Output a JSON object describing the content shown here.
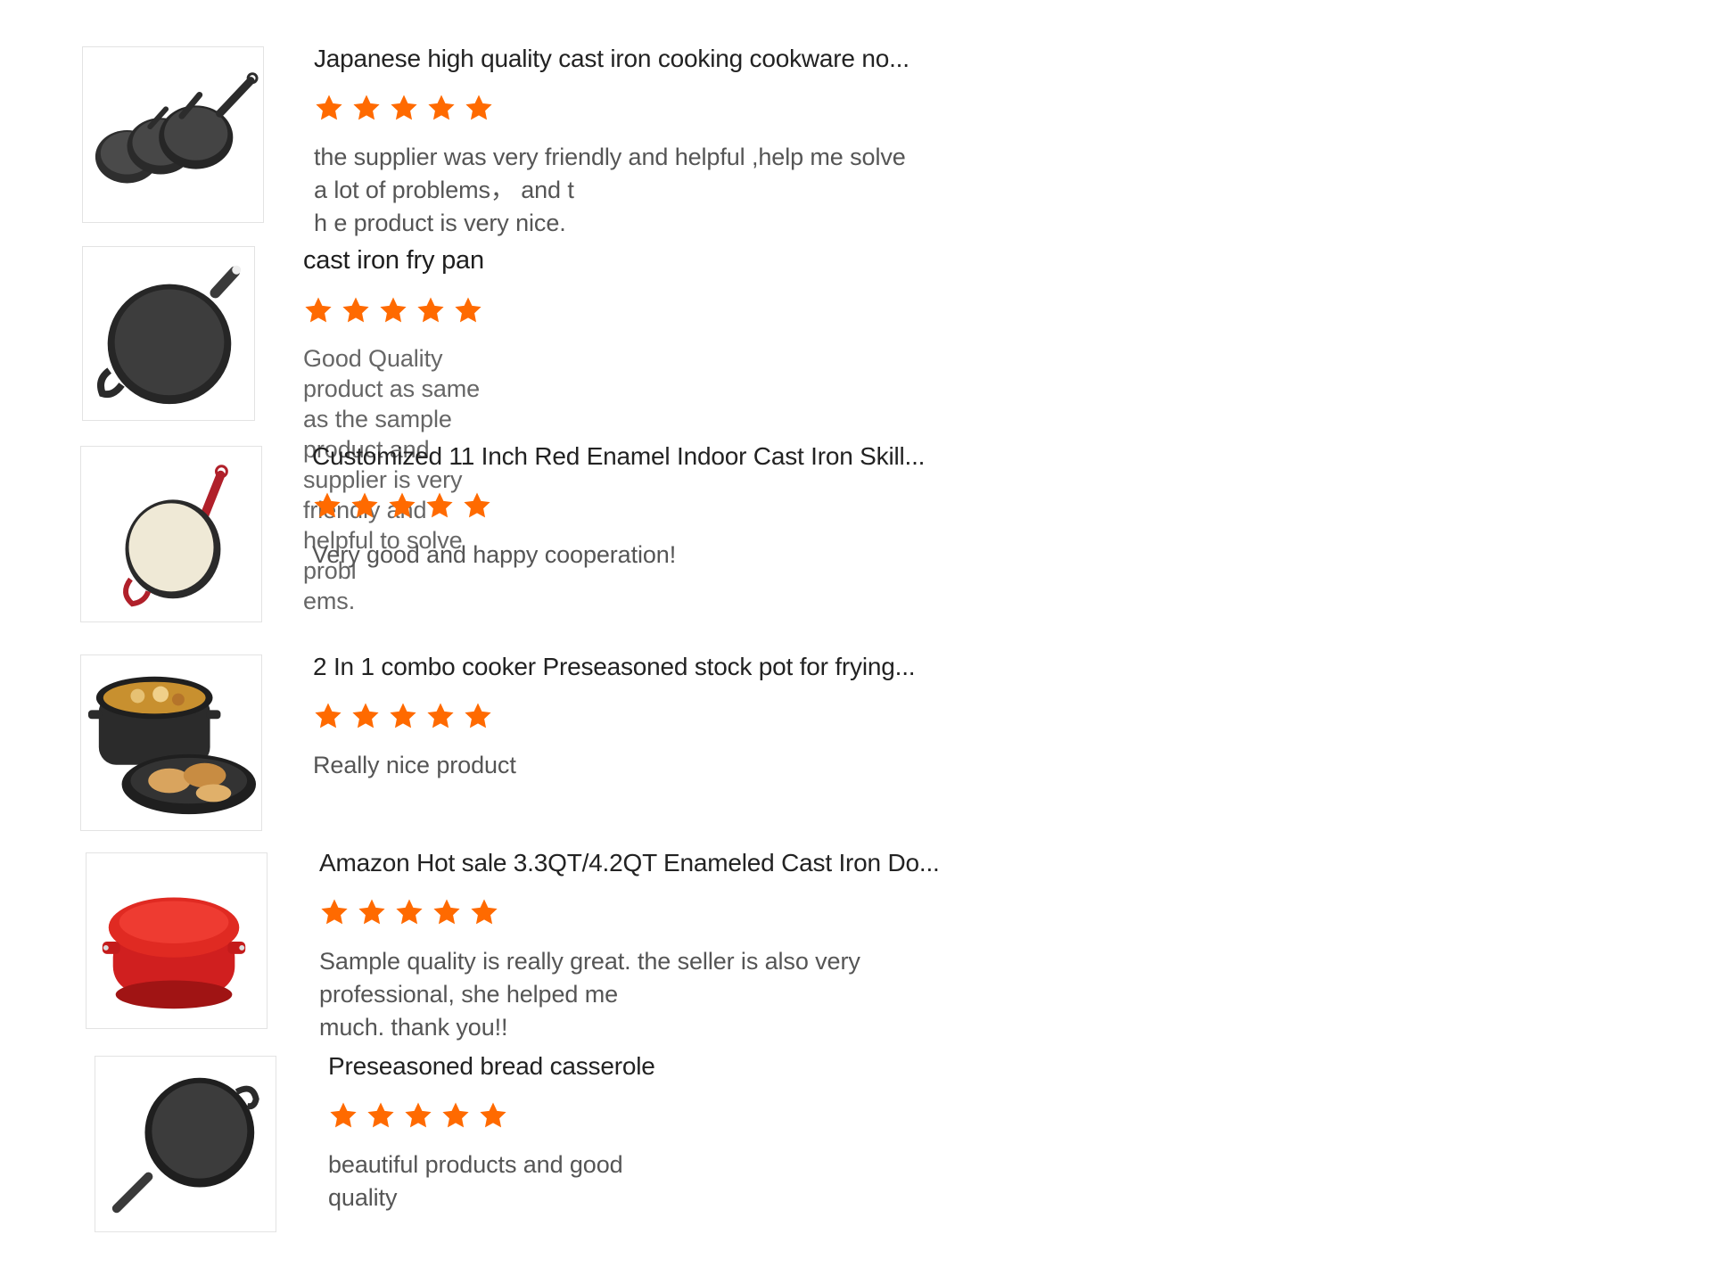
{
  "colors": {
    "star": "#ff6a00",
    "border": "#e3e3e3",
    "title": "#222222",
    "body_text": "#555555"
  },
  "reviews": [
    {
      "image": "cast-iron-skillet-set-image",
      "title": "Japanese high quality cast iron cooking cookware no...",
      "rating": 5,
      "text_lines": [
        "the supplier was very friendly and helpful ,help me solve a lot of problems， and t",
        "h e product is very nice."
      ]
    },
    {
      "image": "cast-iron-fry-pan-image",
      "title": "cast iron fry pan",
      "rating": 5,
      "text_lines": [
        "Good Quality product as same as the sample product and supplier is very friendly and helpful to solve probl",
        "ems."
      ]
    },
    {
      "image": "red-enamel-skillet-image",
      "title": "Customized 11 Inch Red Enamel Indoor Cast Iron Skill...",
      "rating": 5,
      "text_lines": [
        "Very good and happy cooperation!"
      ]
    },
    {
      "image": "combo-cooker-pot-image",
      "title": "2 In 1 combo cooker Preseasoned stock pot for frying...",
      "rating": 5,
      "text_lines": [
        "Really nice product"
      ]
    },
    {
      "image": "red-dutch-oven-image",
      "title": "Amazon Hot sale 3.3QT/4.2QT Enameled Cast Iron Do...",
      "rating": 5,
      "text_lines": [
        "Sample quality is really great. the seller is also very professional, she helped me",
        "much. thank you!!"
      ]
    },
    {
      "image": "bread-casserole-pan-image",
      "title": "Preseasoned bread casserole",
      "rating": 5,
      "text_lines": [
        "beautiful products and good quality"
      ]
    }
  ]
}
